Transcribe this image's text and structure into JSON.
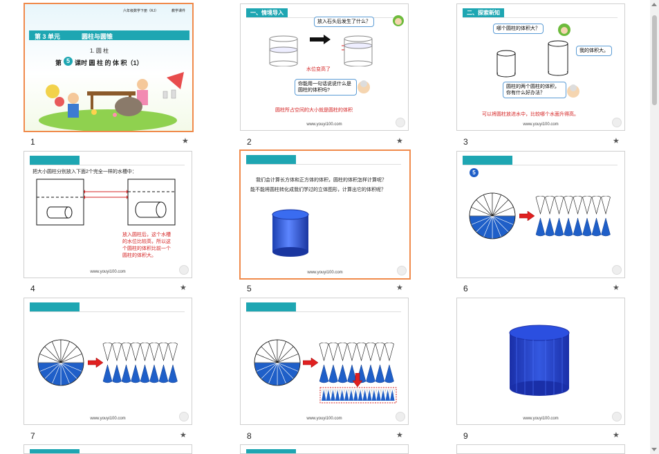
{
  "slides": [
    {
      "number": "1",
      "cover": {
        "course": "六年级数学下册（RJ）",
        "tag": "教学课件",
        "unit": "第 3 单元",
        "unit_title": "圆柱与圆锥",
        "section": "1. 圆 柱",
        "lesson_prefix": "第",
        "lesson_num": "5",
        "lesson_rest": "课时  圆 柱 的 体 积（1）"
      }
    },
    {
      "number": "2",
      "header": "一、情境导入",
      "question": "放入石头后发生了什么？",
      "caption": "水位变高了",
      "bubble2": "你能用一句话说说什么是圆柱的体积吗?",
      "answer": "圆柱所占空间的大小就是圆柱的体积",
      "footer": "www.youyi100.com"
    },
    {
      "number": "3",
      "header": "二、探索新知",
      "question": "哪个圆柱的体积大？",
      "reply": "我的体积大。",
      "bubble2": "圆柱的两个圆柱的体积，你有什么好办法？",
      "answer": "可以将圆柱放进水中，比较哪个水面升得高。",
      "footer": "www.youyi100.com"
    },
    {
      "number": "4",
      "text": "把大小圆柱分别放入下面2个完全一样的水槽中：",
      "answer": [
        "放入圆柱后，这个水槽",
        "的水位比较高，所以这",
        "个圆柱的体积比前一个",
        "圆柱的体积大。"
      ],
      "footer": "www.youyi100.com"
    },
    {
      "number": "5",
      "line1": "我们会计算长方体和正方体的体积，圆柱的体积怎样计算呢？",
      "line2": "能不能将圆柱转化成我们学过的立体图形，计算出它的体积呢？",
      "footer": "www.youyi100.com"
    },
    {
      "number": "6",
      "badge": "5",
      "footer": "www.youyi100.com"
    },
    {
      "number": "7",
      "footer": "www.youyi100.com"
    },
    {
      "number": "8",
      "footer": "www.youyi100.com"
    },
    {
      "number": "9",
      "footer": "www.youyi100.com"
    }
  ],
  "star": "★",
  "colors": {
    "accent": "#1ea6b2",
    "selected": "#f08a4b",
    "blue": "#1f5fc8",
    "red": "#d42020"
  }
}
